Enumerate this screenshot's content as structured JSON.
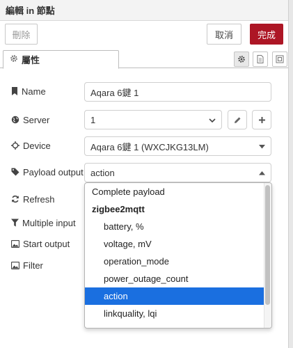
{
  "window": {
    "title": "編輯 in 節點"
  },
  "actions": {
    "delete_label": "刪除",
    "cancel_label": "取消",
    "done_label": "完成"
  },
  "tabs": {
    "properties_label": "屬性",
    "icons": [
      "gear-icon",
      "document-icon",
      "frame-icon"
    ]
  },
  "form": {
    "name": {
      "label": "Name",
      "value": "Aqara 6鍵 1"
    },
    "server": {
      "label": "Server",
      "value": "1"
    },
    "device": {
      "label": "Device",
      "value": "Aqara 6鍵 1 (WXCJKG13LM)"
    },
    "payload_output": {
      "label": "Payload output",
      "value": "action"
    },
    "refresh": {
      "label": "Refresh"
    },
    "multiple_input": {
      "label": "Multiple input"
    },
    "start_output": {
      "label": "Start output"
    },
    "filter": {
      "label": "Filter"
    }
  },
  "dropdown": {
    "options": [
      {
        "label": "Complete payload",
        "kind": "top"
      },
      {
        "label": "zigbee2mqtt",
        "kind": "group"
      },
      {
        "label": "battery, %",
        "kind": "item"
      },
      {
        "label": "voltage, mV",
        "kind": "item"
      },
      {
        "label": "operation_mode",
        "kind": "item"
      },
      {
        "label": "power_outage_count",
        "kind": "item"
      },
      {
        "label": "action",
        "kind": "item",
        "selected": true
      },
      {
        "label": "linkquality, lqi",
        "kind": "item"
      }
    ]
  },
  "colors": {
    "accent_done": "#ad1625",
    "selected_option": "#1a6fe0"
  }
}
